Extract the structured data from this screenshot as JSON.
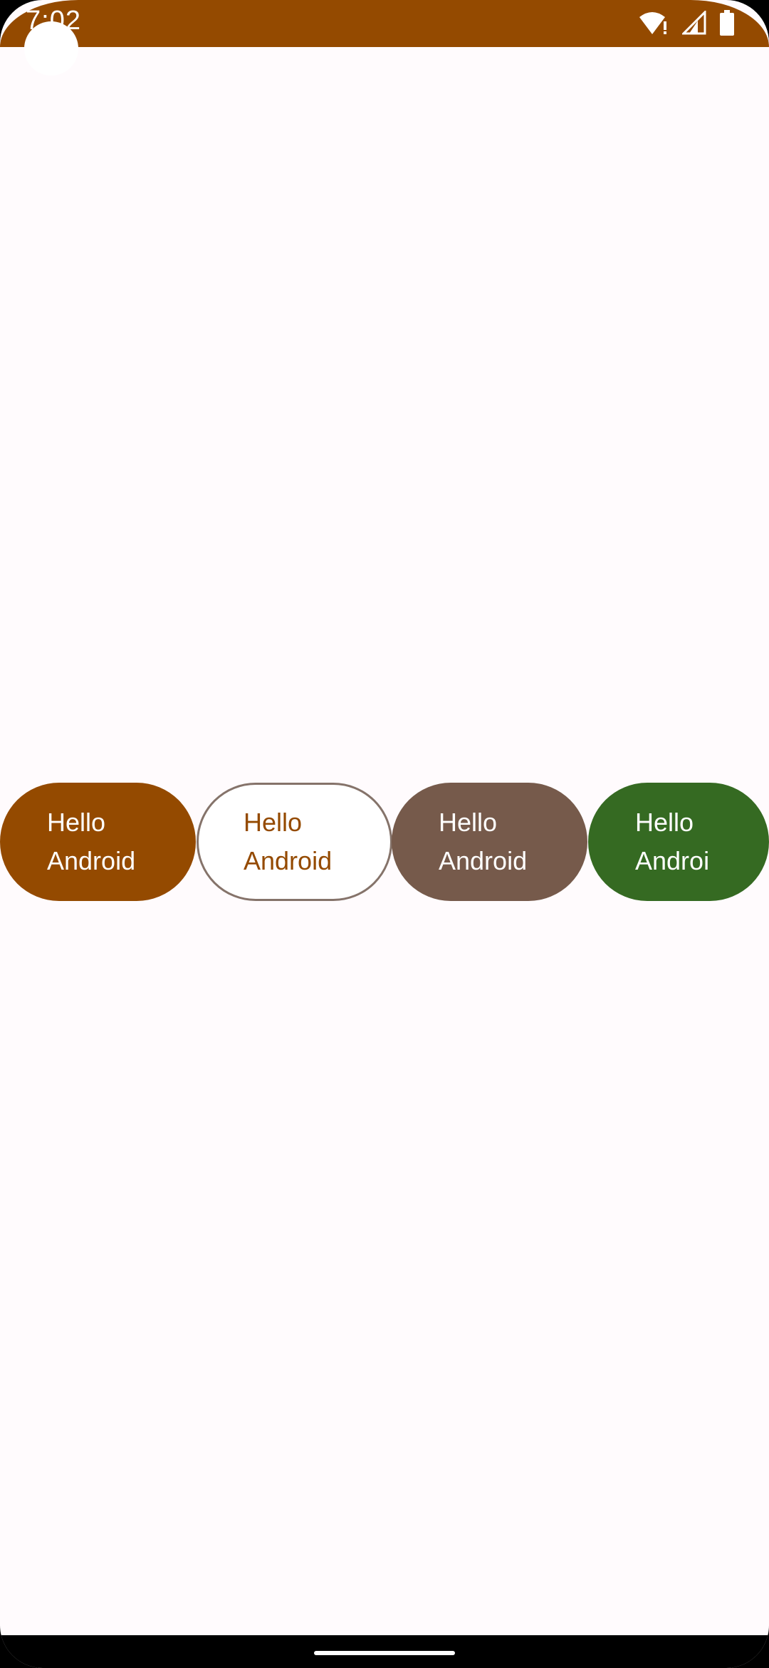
{
  "status_bar": {
    "time": "7:02",
    "icons": [
      "wifi-alert-icon",
      "cellular-signal-icon",
      "battery-icon"
    ],
    "background_color": "#944A00"
  },
  "buttons": [
    {
      "label": "Hello\nAndroid",
      "style": "filled",
      "color": "#944A00"
    },
    {
      "label": "Hello\nAndroid",
      "style": "outlined",
      "color": "#944A00"
    },
    {
      "label": "Hello\nAndroid",
      "style": "tonal",
      "color": "#765A4B"
    },
    {
      "label": "Hello\nAndroi",
      "style": "tertiary",
      "color": "#356A22"
    }
  ]
}
